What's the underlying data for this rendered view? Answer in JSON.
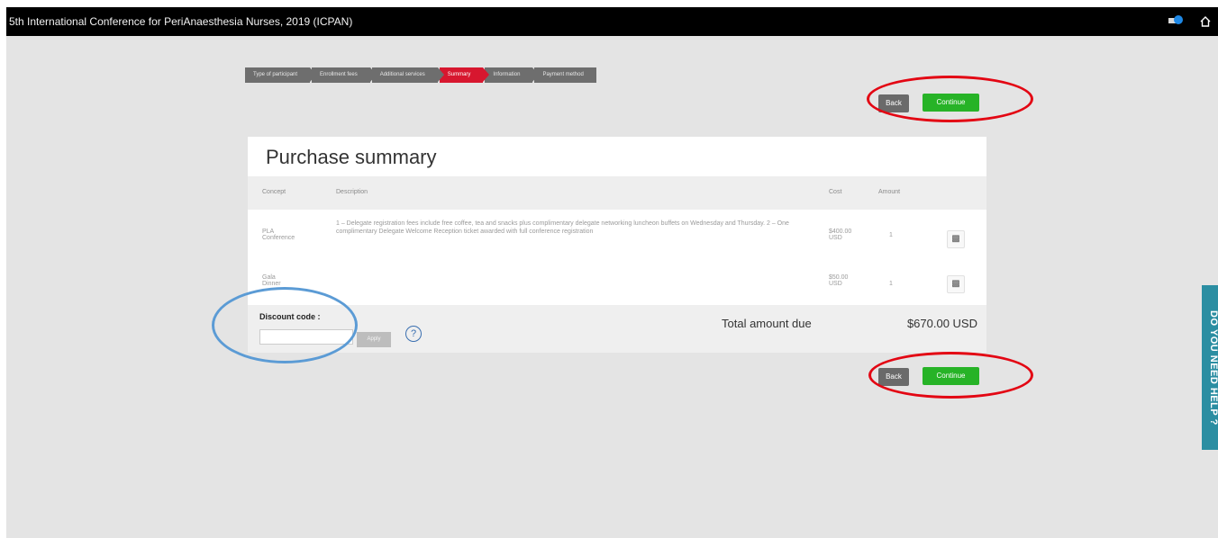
{
  "topbar": {
    "title": "5th International Conference for PeriAnaesthesia Nurses, 2019 (ICPAN)",
    "language_icon": "flag-icon",
    "home_icon": "home-icon"
  },
  "steps": [
    {
      "label": "Type of participant",
      "active": false
    },
    {
      "label": "Enrollment fees",
      "active": false
    },
    {
      "label": "Additional services",
      "active": false
    },
    {
      "label": "Summary",
      "active": true
    },
    {
      "label": "Information",
      "active": false
    },
    {
      "label": "Payment method",
      "active": false
    }
  ],
  "buttons": {
    "back": "Back",
    "continue": "Continue"
  },
  "summary": {
    "title": "Purchase summary",
    "columns": {
      "concept": "Concept",
      "description": "Description",
      "cost": "Cost",
      "amount": "Amount"
    },
    "rows": [
      {
        "concept_line1": "PLA",
        "concept_line2": "Conference",
        "description": "1 – Delegate registration fees include free coffee, tea and snacks plus complimentary delegate networking luncheon buffets on Wednesday and Thursday. 2 – One complimentary Delegate Welcome Reception ticket awarded with full conference registration",
        "cost_line1": "$400.00",
        "cost_line2": "USD",
        "amount": "1"
      },
      {
        "concept_line1": "Gala",
        "concept_line2": "Dinner",
        "description": "",
        "cost_line1": "$50.00",
        "cost_line2": "USD",
        "amount": "1"
      }
    ]
  },
  "discount": {
    "label": "Discount code :",
    "input_value": "",
    "apply_label": "Apply",
    "help_symbol": "?"
  },
  "total": {
    "label": "Total amount due",
    "value": "$670.00 USD"
  },
  "side_help": "DO YOU NEED HELP ?",
  "colors": {
    "accent_red": "#d7172f",
    "continue_green": "#27b327",
    "help_blue": "#2b8ea2",
    "annotation_red": "#e30613",
    "annotation_blue": "#5b9bd5"
  }
}
